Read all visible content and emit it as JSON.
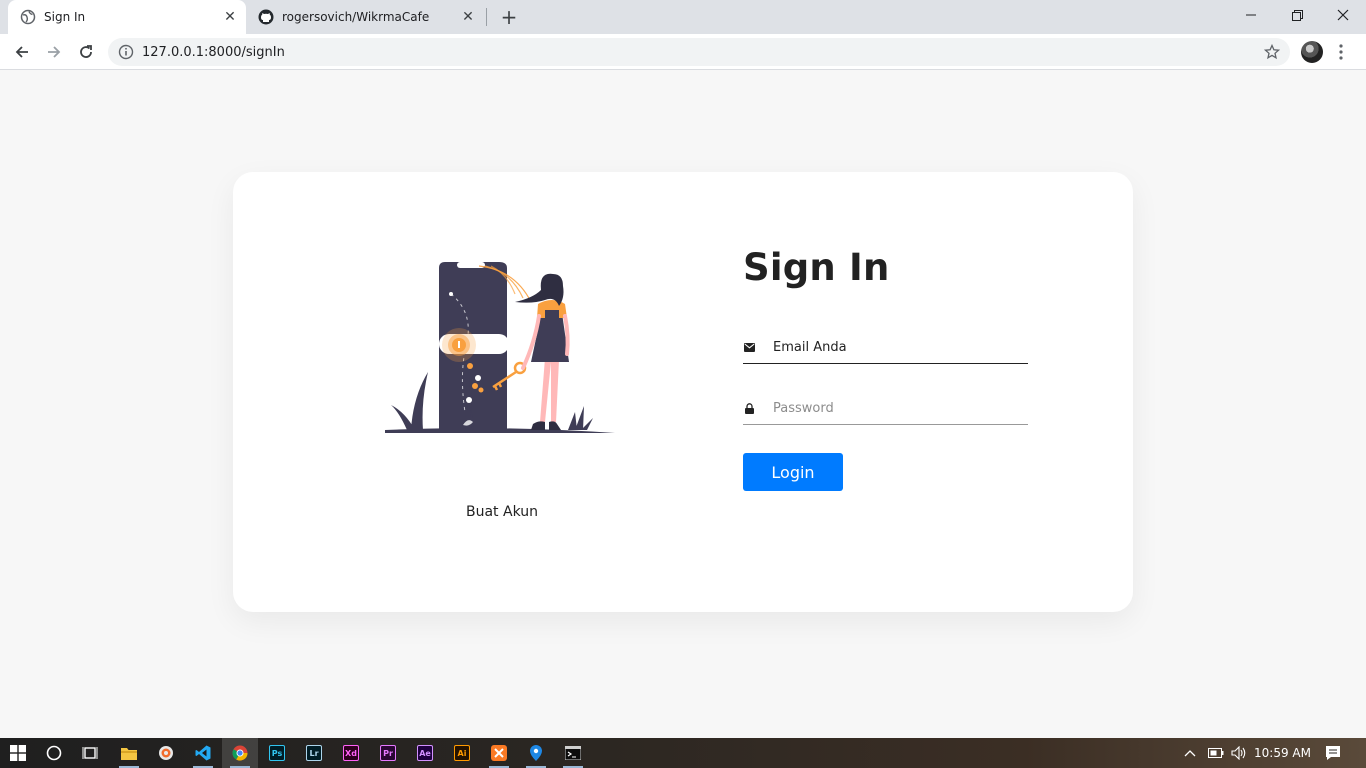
{
  "browser": {
    "tabs": [
      {
        "title": "Sign In",
        "favicon": "globe-icon",
        "active": true
      },
      {
        "title": "rogersovich/WikrmaCafe",
        "favicon": "github-icon",
        "active": false
      }
    ],
    "url": "127.0.0.1:8000/signIn"
  },
  "page": {
    "illustration": "person-with-key-and-phone-illustration",
    "register_link": "Buat Akun",
    "title": "Sign In",
    "email_placeholder": "Email Anda",
    "password_placeholder": "Password",
    "login_label": "Login"
  },
  "colors": {
    "accent": "#007bff",
    "illustration_primary": "#3f3d56",
    "illustration_accent": "#f9a03f"
  },
  "taskbar": {
    "apps": [
      "file-explorer-icon",
      "media-player-icon",
      "vscode-icon",
      "chrome-icon",
      "photoshop-icon",
      "lightroom-icon",
      "xd-icon",
      "premiere-icon",
      "after-effects-icon",
      "illustrator-icon",
      "xampp-icon",
      "maps-icon",
      "terminal-icon"
    ],
    "app_labels": {
      "ps": "Ps",
      "lr": "Lr",
      "xd": "Xd",
      "pr": "Pr",
      "ae": "Ae",
      "ai": "Ai"
    },
    "time": "10:59 AM"
  }
}
